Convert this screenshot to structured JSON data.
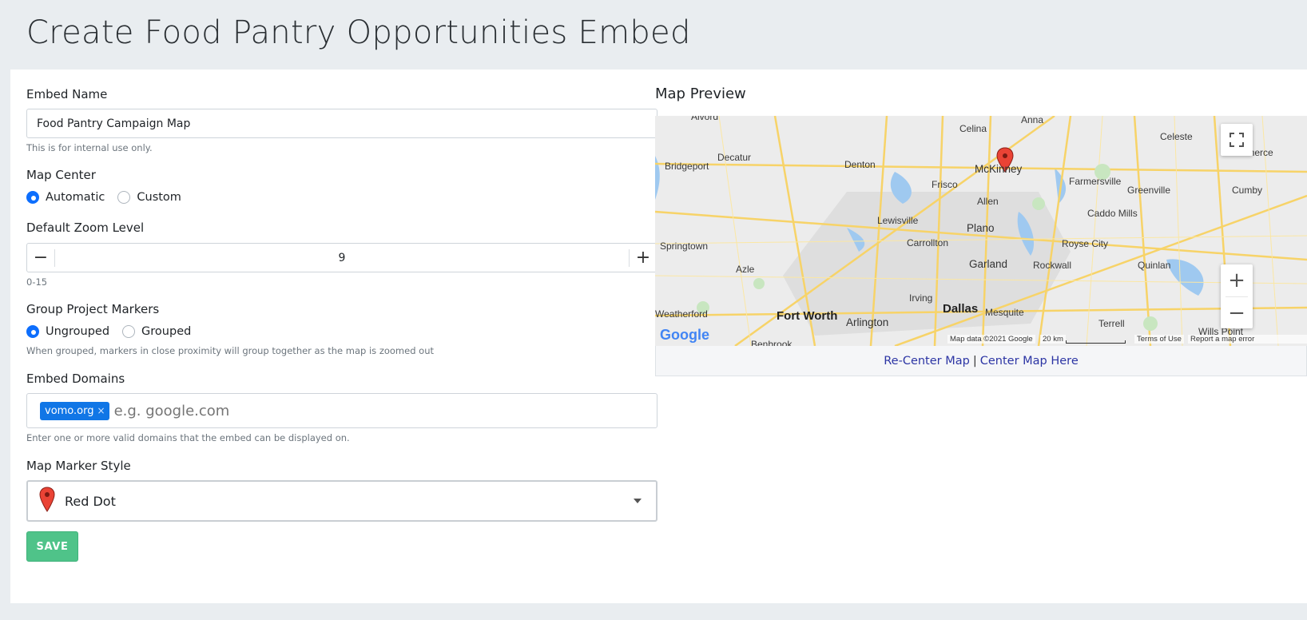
{
  "page": {
    "title": "Create Food Pantry Opportunities Embed"
  },
  "form": {
    "embed_name": {
      "label": "Embed Name",
      "value": "Food Pantry Campaign Map",
      "help": "This is for internal use only."
    },
    "map_center": {
      "label": "Map Center",
      "options": [
        {
          "label": "Automatic",
          "checked": true
        },
        {
          "label": "Custom",
          "checked": false
        }
      ]
    },
    "zoom": {
      "label": "Default Zoom Level",
      "minus": "−",
      "plus": "+",
      "value": "9",
      "help": "0-15"
    },
    "group_markers": {
      "label": "Group Project Markers",
      "options": [
        {
          "label": "Ungrouped",
          "checked": true
        },
        {
          "label": "Grouped",
          "checked": false
        }
      ],
      "help": "When grouped, markers in close proximity will group together as the map is zoomed out"
    },
    "domains": {
      "label": "Embed Domains",
      "tags": [
        {
          "label": "vomo.org",
          "remove": "×"
        }
      ],
      "placeholder": "e.g. google.com",
      "help": "Enter one or more valid domains that the embed can be displayed on."
    },
    "marker_style": {
      "label": "Map Marker Style",
      "selected": "Red Dot",
      "icon": "map-pin-icon"
    },
    "save_label": "SAVE"
  },
  "map": {
    "title": "Map Preview",
    "recenter_label": "Re-Center Map",
    "separator": "|",
    "center_here_label": "Center Map Here",
    "zoom_in": "+",
    "zoom_out": "−",
    "fullscreen_icon": "fullscreen-icon",
    "logo": "Google",
    "attribution": "Map data ©2021 Google",
    "scale": "20 km",
    "terms": "Terms of Use",
    "report": "Report a map error",
    "cities": [
      "Alvord",
      "Celina",
      "Anna",
      "Celeste",
      "Decatur",
      "Denton",
      "McKinney",
      "Commerce",
      "Bridgeport",
      "Frisco",
      "Farmersville",
      "Greenville",
      "Cumby",
      "Allen",
      "Lewisville",
      "Caddo Mills",
      "Plano",
      "Royse City",
      "Carrollton",
      "Springtown",
      "Azle",
      "Garland",
      "Rockwall",
      "Quinlan",
      "Irving",
      "Dallas",
      "Mesquite",
      "Fort Worth",
      "Arlington",
      "Weatherford",
      "Terrell",
      "Wills Point",
      "Benbrook"
    ],
    "colors": {
      "marker": "#ea4335",
      "water": "#9fc9f0",
      "road": "#f7d368",
      "land": "#ececec"
    }
  }
}
